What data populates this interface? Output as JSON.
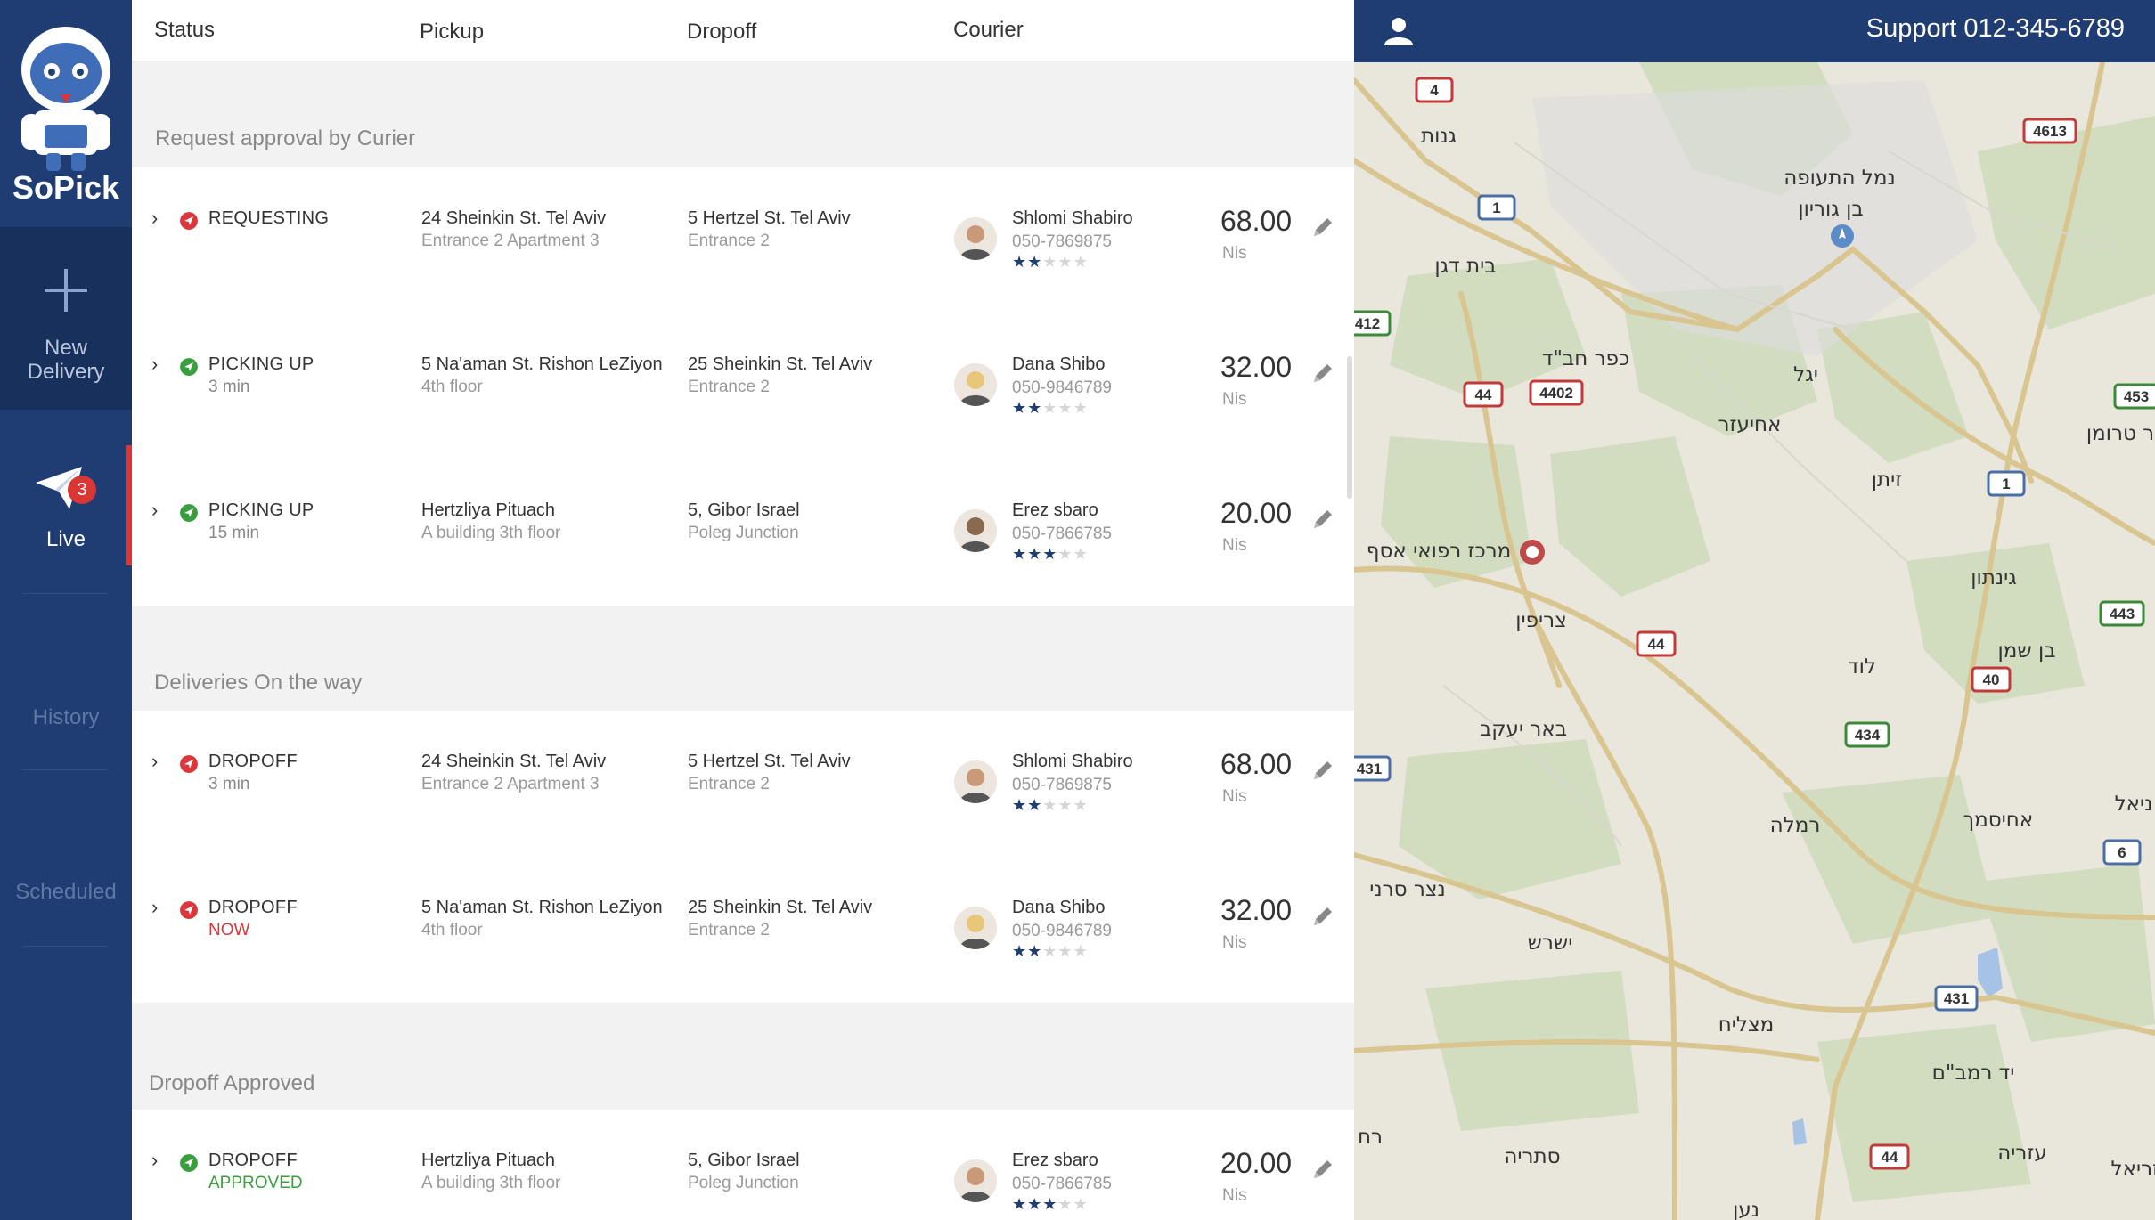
{
  "brand": {
    "name": "SoPick",
    "accent": "#1f3d72",
    "live_bar": "#d93636"
  },
  "sidebar": {
    "new_delivery": {
      "line1": "New",
      "line2": "Delivery"
    },
    "live": {
      "label": "Live",
      "badge": "3"
    },
    "history": "History",
    "scheduled": "Scheduled"
  },
  "columns": {
    "status": "Status",
    "pickup": "Pickup",
    "dropoff": "Dropoff",
    "courier": "Courier"
  },
  "sections": [
    {
      "title": "Request approval by Curier",
      "rows": [
        {
          "status": "REQUESTING",
          "status_sub": "",
          "status_color": "#d9373b",
          "pickup1": "24 Sheinkin St. Tel Aviv",
          "pickup2": "Entrance 2 Apartment 3",
          "drop1": "5 Hertzel St. Tel Aviv",
          "drop2": "Entrance 2",
          "courier": "Shlomi Shabiro",
          "phone": "050-7869875",
          "rating": 2,
          "price": "68.00",
          "currency": "Nis"
        },
        {
          "status": "PICKING UP",
          "status_sub": "3 min",
          "status_color": "#3a9e3e",
          "pickup1": "5 Na'aman St. Rishon LeZiyon",
          "pickup2": "4th floor",
          "drop1": "25 Sheinkin St. Tel Aviv",
          "drop2": "Entrance 2",
          "courier": "Dana Shibo",
          "phone": "050-9846789",
          "rating": 2,
          "price": "32.00",
          "currency": "Nis"
        },
        {
          "status": "PICKING UP",
          "status_sub": "15 min",
          "status_color": "#3a9e3e",
          "pickup1": "Hertzliya Pituach",
          "pickup2": "A building 3th floor",
          "drop1": "5, Gibor Israel",
          "drop2": "Poleg Junction",
          "courier": "Erez sbaro",
          "phone": "050-7866785",
          "rating": 3,
          "price": "20.00",
          "currency": "Nis"
        }
      ]
    },
    {
      "title": "Deliveries On the way",
      "rows": [
        {
          "status": "DROPOFF",
          "status_sub": "3 min",
          "status_color": "#d9373b",
          "pickup1": "24 Sheinkin St. Tel Aviv",
          "pickup2": "Entrance 2 Apartment 3",
          "drop1": "5 Hertzel St. Tel Aviv",
          "drop2": "Entrance 2",
          "courier": "Shlomi Shabiro",
          "phone": "050-7869875",
          "rating": 2,
          "price": "68.00",
          "currency": "Nis"
        },
        {
          "status": "DROPOFF",
          "status_sub": "NOW",
          "status_color": "#d9373b",
          "pickup1": "5 Na'aman St. Rishon LeZiyon",
          "pickup2": "4th floor",
          "drop1": "25 Sheinkin St. Tel Aviv",
          "drop2": "Entrance 2",
          "courier": "Dana Shibo",
          "phone": "050-9846789",
          "rating": 2,
          "price": "32.00",
          "currency": "Nis"
        }
      ]
    },
    {
      "title": "Dropoff Approved",
      "rows": [
        {
          "status": "DROPOFF",
          "status_sub": "APPROVED",
          "status_color": "#3a9e3e",
          "pickup1": "Hertzliya Pituach",
          "pickup2": "A building 3th floor",
          "drop1": "5, Gibor Israel",
          "drop2": "Poleg Junction",
          "courier": "Erez sbaro",
          "phone": "050-7866785",
          "rating": 3,
          "price": "20.00",
          "currency": "Nis"
        }
      ]
    }
  ],
  "topbar": {
    "support": "Support 012-345-6789"
  },
  "map": {
    "places": [
      "גנות",
      "נמל התעופה",
      "בן גוריון",
      "בית דגן",
      "כפר חב\"ד",
      "יגל",
      "אחיעזר",
      "זיתן",
      "מרכז רפואי אסף",
      "צריפין",
      "גינתון",
      "בן שמן",
      "לוד",
      "באר יעקב",
      "רמלה",
      "אחיסמך",
      "נצר סרני",
      "ישרש",
      "מצליח",
      "יד רמב\"ם",
      "סתריה",
      "עזריה",
      "נען",
      "ר טרומן",
      "ניאל",
      "רח",
      "עזריאל"
    ],
    "shields_white": [
      "4",
      "1",
      "4613",
      "412",
      "4402",
      "1",
      "431",
      "431",
      "6"
    ],
    "shields_red": [
      "44",
      "44",
      "40",
      "44"
    ],
    "shields_green": [
      "453",
      "443",
      "434"
    ]
  }
}
